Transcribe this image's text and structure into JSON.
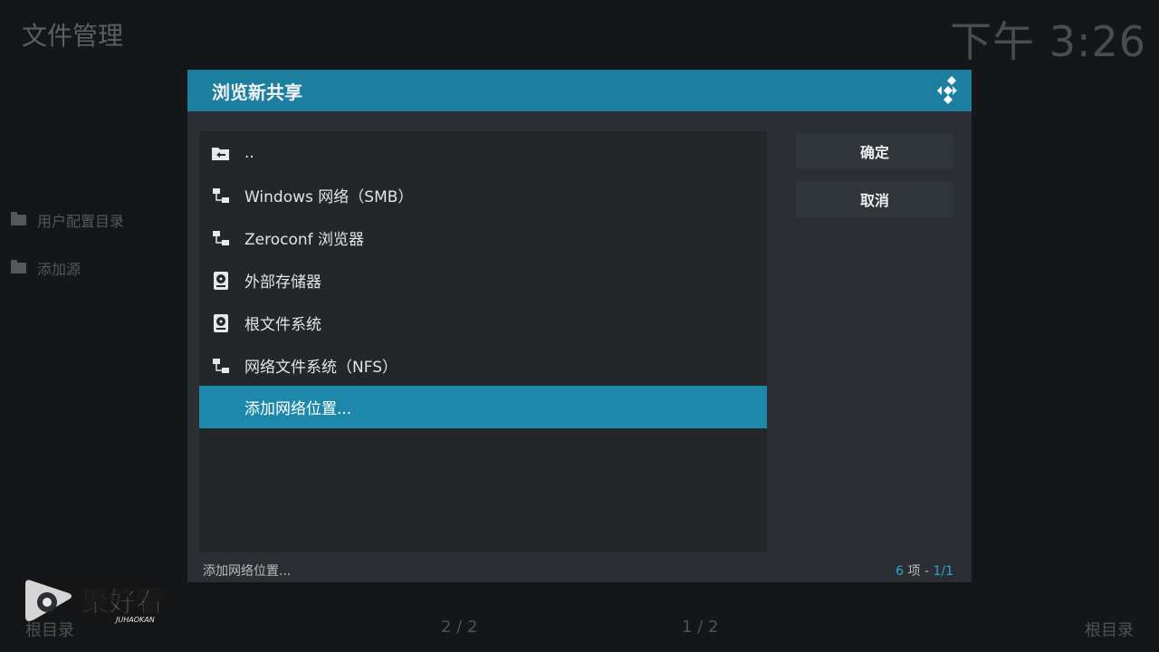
{
  "background": {
    "page_title": "文件管理",
    "clock": "下午 3:26",
    "sidebar_items": [
      "用户配置目录",
      "添加源"
    ],
    "footer": {
      "left": "根目录",
      "center_left": "2 / 2",
      "center_right": "1 / 2",
      "right": "根目录"
    }
  },
  "dialog": {
    "title": "浏览新共享",
    "items": [
      {
        "label": "..",
        "icon": "folder-back-icon"
      },
      {
        "label": "Windows 网络（SMB）",
        "icon": "network-icon"
      },
      {
        "label": "Zeroconf 浏览器",
        "icon": "network-icon"
      },
      {
        "label": "外部存储器",
        "icon": "harddisk-icon"
      },
      {
        "label": "根文件系统",
        "icon": "harddisk-icon"
      },
      {
        "label": "网络文件系统（NFS）",
        "icon": "network-icon"
      },
      {
        "label": "添加网络位置...",
        "icon": "",
        "selected": true
      }
    ],
    "buttons": {
      "ok": "确定",
      "cancel": "取消"
    },
    "status": {
      "selected_label": "添加网络位置...",
      "count": "6",
      "count_suffix": "项 -",
      "page": "1/1"
    }
  },
  "watermark": {
    "brand": "聚好看",
    "sub": "JUHAOKAN"
  },
  "colors": {
    "accent": "#1d7fa0",
    "selection": "#1e88aa",
    "page_info": "#2aa7d2"
  }
}
